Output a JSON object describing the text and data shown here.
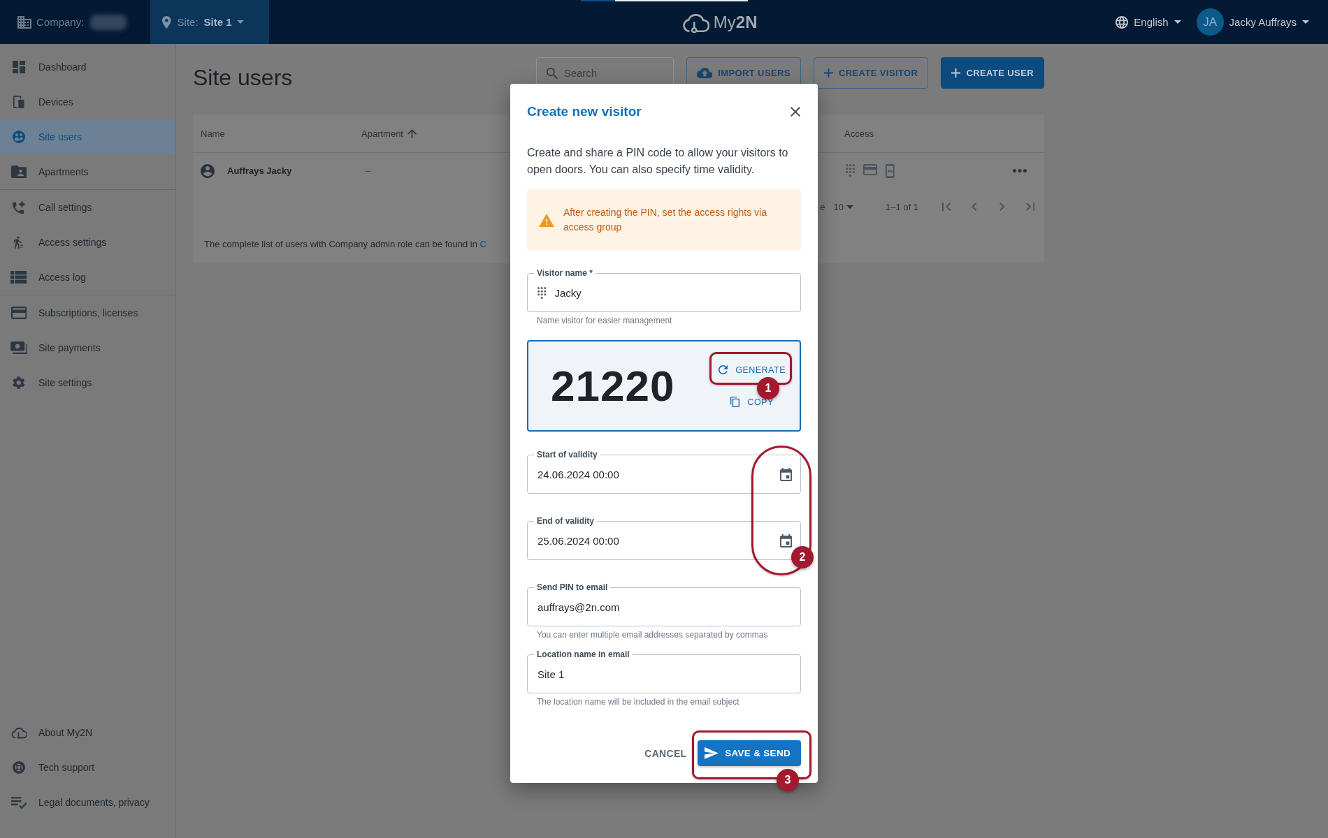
{
  "top_bar": {
    "company": {
      "label": "Company:"
    },
    "site": {
      "label": "Site:",
      "value": "Site 1"
    },
    "logo": "My**2N**",
    "language": "English",
    "user": {
      "initials": "JA",
      "name": "Jacky Auffrays"
    }
  },
  "sidebar": {
    "groups": [
      {
        "items": [
          {
            "label": "Dashboard",
            "selected": false
          },
          {
            "label": "Devices",
            "selected": false
          },
          {
            "label": "Site users",
            "selected": true
          },
          {
            "label": "Apartments",
            "selected": false
          }
        ]
      },
      {
        "items": [
          {
            "label": "Call settings",
            "selected": false
          },
          {
            "label": "Access settings",
            "selected": false
          },
          {
            "label": "Access log",
            "selected": false
          }
        ]
      },
      {
        "items": [
          {
            "label": "Subscriptions, licenses",
            "selected": false
          },
          {
            "label": "Site payments",
            "selected": false
          },
          {
            "label": "Site settings",
            "selected": false
          }
        ]
      }
    ],
    "footer_items": [
      {
        "label": "About My2N"
      },
      {
        "label": "Tech support"
      },
      {
        "label": "Legal documents, privacy"
      }
    ]
  },
  "page": {
    "title": "Site users",
    "search": {
      "placeholder": "Search"
    },
    "buttons": [
      {
        "label": "IMPORT USERS",
        "kind": "outlined"
      },
      {
        "label": "CREATE VISITOR",
        "kind": "outlined"
      },
      {
        "label": "CREATE USER",
        "kind": "filled"
      }
    ],
    "table": {
      "columns": [
        {
          "label": "Name",
          "sorted": false
        },
        {
          "label": "Apartment",
          "sorted": true
        },
        {
          "label": "Access",
          "sorted": false
        }
      ],
      "rows": [
        {
          "name": "Auffrays Jacky",
          "apartment": "–"
        }
      ],
      "pagination": {
        "rows_per_page_label": "e",
        "rows_per_page": "10",
        "range": "1–1 of 1"
      }
    },
    "note": {
      "text": "The complete list of users with Company admin role can be found in",
      "link": "C"
    }
  },
  "modal": {
    "title": "Create new visitor",
    "description": "Create and share a PIN code to allow your visitors to open doors. You can also specify time validity.",
    "warning": "After creating the PIN, set the access rights via access group",
    "visitor_name": {
      "label": "Visitor name *",
      "value": "Jacky",
      "helper": "Name visitor for easier management"
    },
    "pin": {
      "code": "21220",
      "actions": [
        {
          "label": "GENERATE"
        },
        {
          "label": "COPY"
        }
      ]
    },
    "validity": [
      {
        "label": "Start of validity",
        "value": "24.06.2024 00:00"
      },
      {
        "label": "End of validity",
        "value": "25.06.2024 00:00"
      }
    ],
    "email": {
      "label": "Send PIN to email",
      "value": "auffrays@2n.com",
      "helper": "You can enter multiple email addresses separated by commas"
    },
    "location": {
      "label": "Location name in email",
      "value": "Site 1",
      "helper": "The location name will be included in the email subject"
    },
    "buttons": [
      {
        "label": "CANCEL",
        "kind": "text"
      },
      {
        "label": "SAVE & SEND",
        "kind": "primary"
      }
    ]
  },
  "annotations": [
    {
      "number": "1"
    },
    {
      "number": "2"
    },
    {
      "number": "3"
    }
  ]
}
